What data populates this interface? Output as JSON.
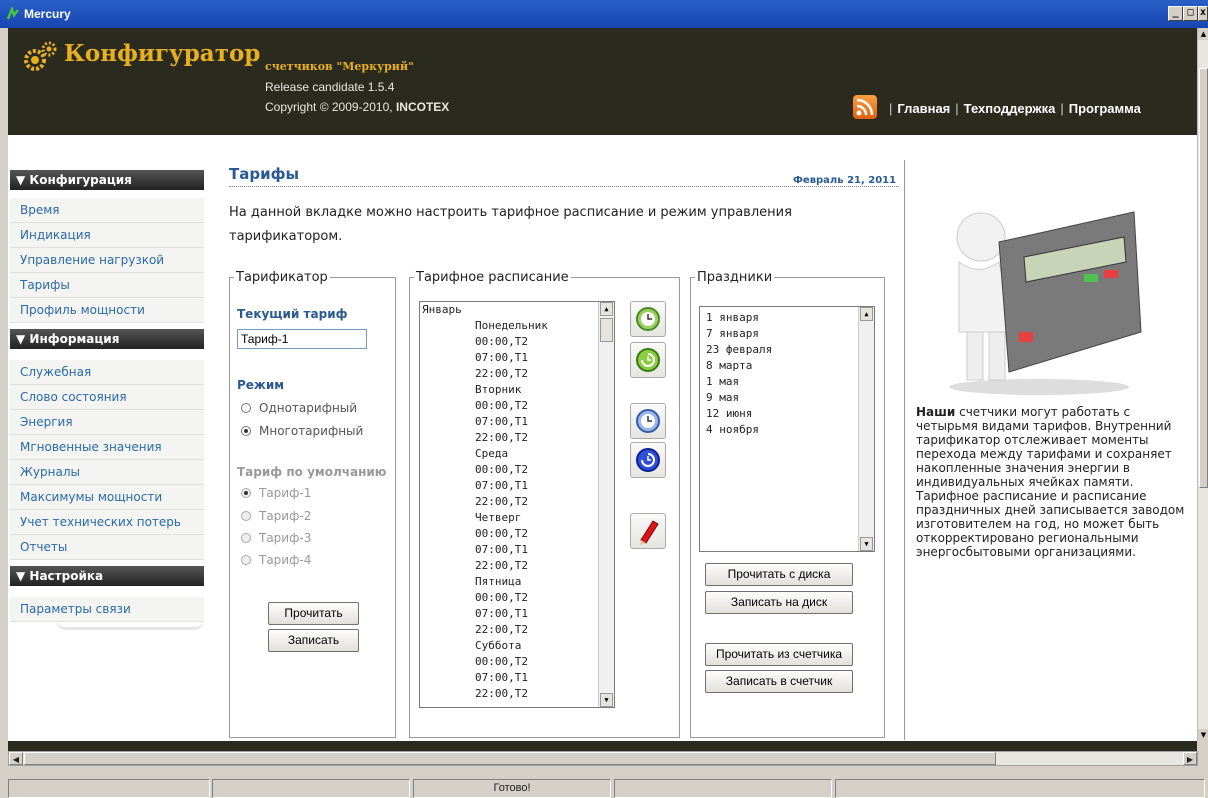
{
  "window": {
    "title": "Mercury",
    "min_icon": "_",
    "max_icon": "□",
    "close_icon": "x"
  },
  "header": {
    "brand_title": "Конфигуратор",
    "brand_subtitle": "счетчиков \"Меркурий\"",
    "release": "Release candidate 1.5.4",
    "copyright_prefix": "Copyright © 2009-2010,",
    "copyright_company": "INCOTEX",
    "nav": [
      "Главная",
      "Техподдержка",
      "Программа"
    ],
    "nav_separator": "|",
    "rss_icon": "rss-icon",
    "brand_icon": "gear-icon",
    "accent_color": "#e8b020"
  },
  "sidebar": {
    "sections": [
      {
        "title": "▼ Конфигурация",
        "items": [
          "Время",
          "Индикация",
          "Управление нагрузкой",
          "Тарифы",
          "Профиль мощности"
        ]
      },
      {
        "title": "▼ Информация",
        "items": [
          "Служебная",
          "Слово состояния",
          "Энергия",
          "Мгновенные значения",
          "Журналы",
          "Максимумы мощности",
          "Учет технических потерь",
          "Отчеты"
        ]
      },
      {
        "title": "▼ Настройка",
        "items": [
          "Параметры связи"
        ]
      }
    ]
  },
  "main": {
    "title": "Тарифы",
    "date": "Февраль 21, 2011",
    "intro": "На данной вкладке можно настроить тарифное расписание и режим управления тарификатором.",
    "tarifikator": {
      "legend": "Тарификатор",
      "current_label": "Текущий тариф",
      "current_value": "Тариф-1",
      "mode_label": "Режим",
      "modes": [
        "Однотарифный",
        "Многотарифный"
      ],
      "mode_selected": "Многотарифный",
      "default_label": "Тариф по умолчанию",
      "default_options": [
        "Тариф-1",
        "Тариф-2",
        "Тариф-3",
        "Тариф-4"
      ],
      "default_selected": "Тариф-1",
      "read_button": "Прочитать",
      "write_button": "Записать"
    },
    "schedule": {
      "legend": "Тарифное расписание",
      "rows": [
        "Январь",
        "        Понедельник",
        "        00:00,T2",
        "        07:00,T1",
        "        22:00,T2",
        "        Вторник",
        "        00:00,T2",
        "        07:00,T1",
        "        22:00,T2",
        "        Среда",
        "        00:00,T2",
        "        07:00,T1",
        "        22:00,T2",
        "        Четверг",
        "        00:00,T2",
        "        07:00,T1",
        "        22:00,T2",
        "        Пятница",
        "        00:00,T2",
        "        07:00,T1",
        "        22:00,T2",
        "        Суббота",
        "        00:00,T2",
        "        07:00,T1",
        "        22:00,T2"
      ],
      "tool_icons": [
        "clock-add-icon",
        "clock-refresh-icon",
        "clock-edit-icon",
        "clock-history-icon",
        "eraser-icon"
      ]
    },
    "holidays": {
      "legend": "Праздники",
      "items": [
        "1 января",
        "7 января",
        "23 февраля",
        "8 марта",
        "1 мая",
        "9 мая",
        "12 июня",
        "4 ноября"
      ],
      "read_disk": "Прочитать с диска",
      "write_disk": "Записать на диск",
      "read_meter": "Прочитать из счетчика",
      "write_meter": "Записать в счетчик"
    }
  },
  "aside": {
    "lead": "Наши",
    "text": " счетчики могут работать с четырьмя видами тарифов. Внутренний тарификатор отслеживает моменты перехода между тарифами и сохраняет накопленные значения энергии в индивидуальных ячейках памяти. Тарифное расписание и расписание праздничных дней записывается заводом изготовителем на год, но может быть откорректировано региональными энергосбытовыми организациями.",
    "image_icon": "calculator-figure-icon"
  },
  "statusbar": {
    "text": "Готово!"
  }
}
